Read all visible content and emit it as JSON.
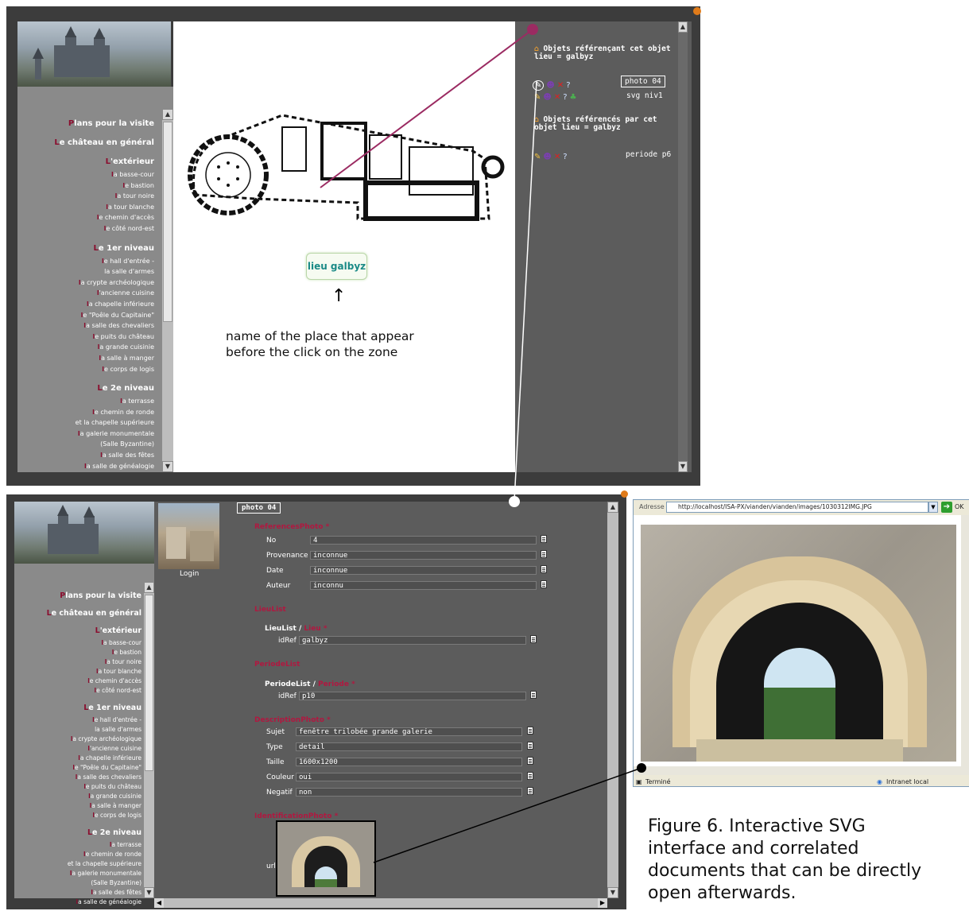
{
  "top": {
    "nav": [
      {
        "cap": "P",
        "rest": "lans pour la visite",
        "type": "h"
      },
      {
        "cap": "L",
        "rest": "e château en général",
        "type": "h"
      },
      {
        "cap": "L",
        "rest": "'extérieur",
        "type": "h"
      },
      {
        "cap": "l",
        "rest": "a basse-cour",
        "type": "i"
      },
      {
        "cap": "l",
        "rest": "e bastion",
        "type": "i"
      },
      {
        "cap": "l",
        "rest": "a tour noire",
        "type": "i"
      },
      {
        "cap": "l",
        "rest": "a tour blanche",
        "type": "i"
      },
      {
        "cap": "l",
        "rest": "e chemin d'accès",
        "type": "i"
      },
      {
        "cap": "l",
        "rest": "e côté nord-est",
        "type": "i"
      },
      {
        "cap": "L",
        "rest": "e 1er niveau",
        "type": "h"
      },
      {
        "cap": "l",
        "rest": "e hall d'entrée -",
        "type": "i"
      },
      {
        "cap": "",
        "rest": "la salle d'armes",
        "type": "i"
      },
      {
        "cap": "l",
        "rest": "a crypte archéologique",
        "type": "i"
      },
      {
        "cap": "l",
        "rest": "'ancienne cuisine",
        "type": "i"
      },
      {
        "cap": "l",
        "rest": "a chapelle inférieure",
        "type": "i"
      },
      {
        "cap": "l",
        "rest": "e \"Poêle du Capitaine\"",
        "type": "i"
      },
      {
        "cap": "l",
        "rest": "a salle des chevaliers",
        "type": "i"
      },
      {
        "cap": "l",
        "rest": "e puits du château",
        "type": "i"
      },
      {
        "cap": "l",
        "rest": "a grande cuisinie",
        "type": "i"
      },
      {
        "cap": "l",
        "rest": "a salle à manger",
        "type": "i"
      },
      {
        "cap": "l",
        "rest": "e corps de logis",
        "type": "i"
      },
      {
        "cap": "L",
        "rest": "e 2e niveau",
        "type": "h"
      },
      {
        "cap": "l",
        "rest": "a terrasse",
        "type": "i"
      },
      {
        "cap": "l",
        "rest": "e chemin de ronde",
        "type": "i"
      },
      {
        "cap": "",
        "rest": "et la chapelle supérieure",
        "type": "i"
      },
      {
        "cap": "l",
        "rest": "a galerie monumentale",
        "type": "i"
      },
      {
        "cap": "",
        "rest": "(Salle Byzantine)",
        "type": "i"
      },
      {
        "cap": "l",
        "rest": "a salle des fêtes",
        "type": "i"
      },
      {
        "cap": "l",
        "rest": "a salle de généalogie",
        "type": "i"
      }
    ],
    "referencing_head_1": "Objets référençant cet objet",
    "referencing_head_2": "lieu = galbyz",
    "referenced_head_1": "Objets référencés par cet",
    "referenced_head_2": "objet lieu = galbyz",
    "tag_photo": "photo 04",
    "tag_svg": "svg niv1",
    "tag_periode": "periode p6",
    "place_label": "lieu galbyz",
    "note_line1": "name of the place that appear",
    "note_line2": "before the click on the zone"
  },
  "bottom": {
    "thumb_label": "Login",
    "title_tag": "photo 04",
    "sections": {
      "refs": "ReferencesPhoto",
      "lieulist": "LieuList",
      "periodelist": "PeriodeList",
      "desc": "DescriptionPhoto",
      "ident": "IdentificationPhoto"
    },
    "required_mark": "*",
    "refs_fields": [
      {
        "label": "No",
        "value": "4"
      },
      {
        "label": "Provenance",
        "value": "inconnue"
      },
      {
        "label": "Date",
        "value": "inconnue"
      },
      {
        "label": "Auteur",
        "value": "inconnu"
      }
    ],
    "lieu_path_a": "LieuList /",
    "lieu_path_b": "Lieu",
    "lieu_idref_label": "idRef",
    "lieu_idref_value": "galbyz",
    "periode_path_a": "PeriodeList /",
    "periode_path_b": "Periode",
    "periode_idref_label": "idRef",
    "periode_idref_value": "p10",
    "desc_fields": [
      {
        "label": "Sujet",
        "value": "fenêtre trilobée grande galerie"
      },
      {
        "label": "Type",
        "value": "detail"
      },
      {
        "label": "Taille",
        "value": "1600x1200"
      },
      {
        "label": "Couleur",
        "value": "oui"
      },
      {
        "label": "Negatif",
        "value": "non"
      }
    ],
    "url_label": "url"
  },
  "browser": {
    "address_label": "Adresse",
    "url": "http://localhost/ISA-PX/vianden/vianden/images/1030312IMG.JPG",
    "go_label": "OK",
    "status_left": "Terminé",
    "status_right": "Intranet local"
  },
  "caption": {
    "line1": "Figure 6. Interactive SVG",
    "line2": "interface and correlated",
    "line3": "documents that can be directly",
    "line4": "open afterwards."
  },
  "colors": {
    "accent": "#8b0d2e",
    "link_line": "#9b2b62",
    "place_text": "#1a8a86"
  }
}
